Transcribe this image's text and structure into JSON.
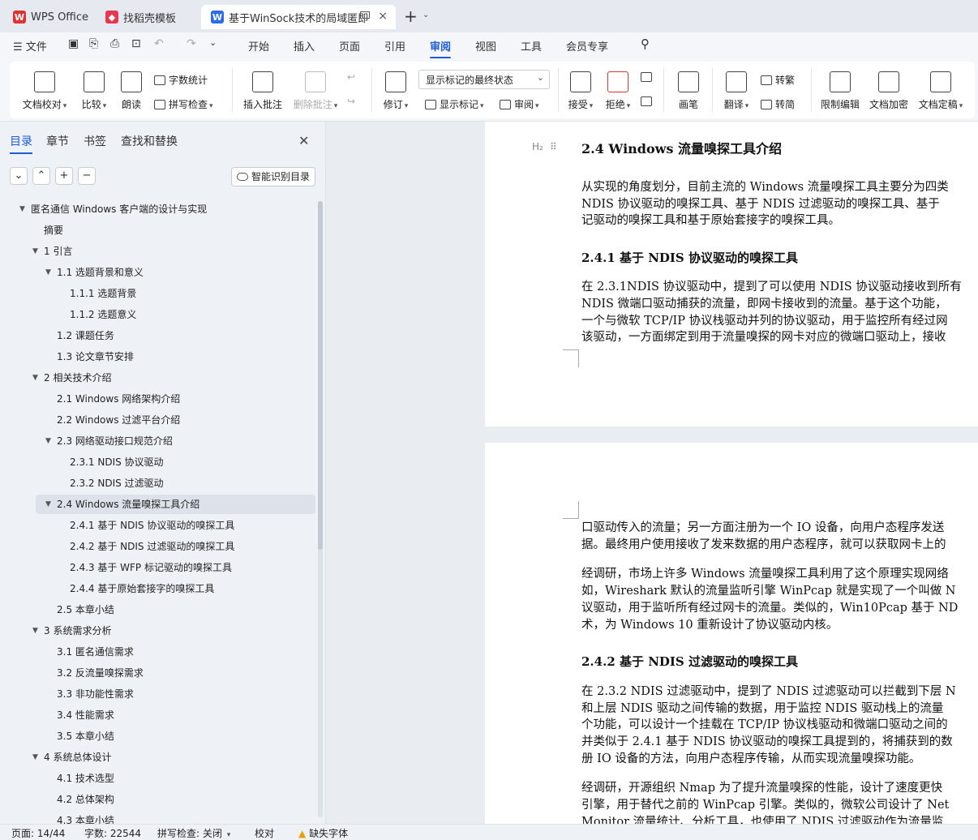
{
  "tabs": [
    {
      "label": "WPS Office",
      "icon": "wps-logo-icon"
    },
    {
      "label": "找稻壳模板",
      "icon": "docer-icon"
    },
    {
      "label": "基于WinSock技术的局域匿即",
      "icon": "word-doc-icon"
    }
  ],
  "new_tab": "+",
  "menu": {
    "file": "文件",
    "items": [
      "开始",
      "插入",
      "页面",
      "引用",
      "审阅",
      "视图",
      "工具",
      "会员专享"
    ],
    "active": "审阅"
  },
  "ribbon": {
    "proofread": "文档校对",
    "compare": "比较",
    "read_aloud": "朗读",
    "word_count": "字数统计",
    "spell_check": "拼写检查",
    "insert_comment": "插入批注",
    "delete_comment": "删除批注",
    "revise": "修订",
    "markup_state": "显示标记的最终状态",
    "show_markup": "显示标记",
    "review": "审阅",
    "accept": "接受",
    "reject": "拒绝",
    "pen": "画笔",
    "translate": "翻译",
    "to_traditional": "转繁",
    "to_simplified": "转简",
    "restrict_edit": "限制编辑",
    "encrypt": "文档加密",
    "finalize": "文档定稿"
  },
  "sidebar": {
    "tabs": [
      "目录",
      "章节",
      "书签",
      "查找和替换"
    ],
    "smart_toc": "智能识别目录",
    "toc": [
      {
        "label": "匿名通信 Windows 客户端的设计与实现",
        "level": 0,
        "arrow": true
      },
      {
        "label": "摘要",
        "level": 1,
        "arrow": false
      },
      {
        "label": "1  引言",
        "level": 1,
        "arrow": true
      },
      {
        "label": "1.1  选题背景和意义",
        "level": 2,
        "arrow": true
      },
      {
        "label": "1.1.1  选题背景",
        "level": 3,
        "arrow": false
      },
      {
        "label": "1.1.2  选题意义",
        "level": 3,
        "arrow": false
      },
      {
        "label": "1.2  课题任务",
        "level": 2,
        "arrow": false
      },
      {
        "label": "1.3  论文章节安排",
        "level": 2,
        "arrow": false
      },
      {
        "label": "2  相关技术介绍",
        "level": 1,
        "arrow": true
      },
      {
        "label": "2.1 Windows  网络架构介绍",
        "level": 2,
        "arrow": false
      },
      {
        "label": "2.2 Windows  过滤平台介绍",
        "level": 2,
        "arrow": false
      },
      {
        "label": "2.3  网络驱动接口规范介绍",
        "level": 2,
        "arrow": true
      },
      {
        "label": "2.3.1 NDIS  协议驱动",
        "level": 3,
        "arrow": false
      },
      {
        "label": "2.3.2 NDIS  过滤驱动",
        "level": 3,
        "arrow": false
      },
      {
        "label": "2.4 Windows  流量嗅探工具介绍",
        "level": 2,
        "arrow": true,
        "selected": true
      },
      {
        "label": "2.4.1  基于  NDIS  协议驱动的嗅探工具",
        "level": 3,
        "arrow": false
      },
      {
        "label": "2.4.2  基于  NDIS  过滤驱动的嗅探工具",
        "level": 3,
        "arrow": false
      },
      {
        "label": "2.4.3  基于  WFP  标记驱动的嗅探工具",
        "level": 3,
        "arrow": false
      },
      {
        "label": "2.4.4  基于原始套接字的嗅探工具",
        "level": 3,
        "arrow": false
      },
      {
        "label": "2.5  本章小结",
        "level": 2,
        "arrow": false
      },
      {
        "label": "3  系统需求分析",
        "level": 1,
        "arrow": true
      },
      {
        "label": "3.1  匿名通信需求",
        "level": 2,
        "arrow": false
      },
      {
        "label": "3.2  反流量嗅探需求",
        "level": 2,
        "arrow": false
      },
      {
        "label": "3.3  非功能性需求",
        "level": 2,
        "arrow": false
      },
      {
        "label": "3.4  性能需求",
        "level": 2,
        "arrow": false
      },
      {
        "label": "3.5  本章小结",
        "level": 2,
        "arrow": false
      },
      {
        "label": "4  系统总体设计",
        "level": 1,
        "arrow": true
      },
      {
        "label": "4.1  技术选型",
        "level": 2,
        "arrow": false
      },
      {
        "label": "4.2  总体架构",
        "level": 2,
        "arrow": false
      },
      {
        "label": "4.3  本章小结",
        "level": 2,
        "arrow": false
      }
    ]
  },
  "doc": {
    "heading_style": "H₂",
    "h24": "2.4 Windows  流量嗅探工具介绍",
    "p1": [
      "从实现的角度划分，目前主流的  Windows  流量嗅探工具主要分为四类",
      "NDIS  协议驱动的嗅探工具、基于  NDIS  过滤驱动的嗅探工具、基于",
      "记驱动的嗅探工具和基于原始套接字的嗅探工具。"
    ],
    "h241": "2.4.1  基于  NDIS  协议驱动的嗅探工具",
    "p2": [
      "在 2.3.1NDIS 协议驱动中，提到了可以使用  NDIS 协议驱动接收到所有",
      "NDIS  微端口驱动捕获的流量，即网卡接收到的流量。基于这个功能，",
      "一个与微软  TCP/IP  协议栈驱动并列的协议驱动，用于监控所有经过网",
      "该驱动，一方面绑定到用于流量嗅探的网卡对应的微端口驱动上，接收"
    ],
    "p3": [
      "口驱动传入的流量；另一方面注册为一个  IO  设备，向用户态程序发送",
      "据。最终用户使用接收了发来数据的用户态程序，就可以获取网卡上的"
    ],
    "p4": [
      "经调研，市场上许多  Windows  流量嗅探工具利用了这个原理实现网络",
      "如，Wireshark  默认的流量监听引擎  WinPcap  就是实现了一个叫做  N",
      "议驱动，用于监听所有经过网卡的流量。类似的，Win10Pcap 基于  ND",
      "术，为  Windows 10  重新设计了协议驱动内核。"
    ],
    "h242": "2.4.2  基于  NDIS  过滤驱动的嗅探工具",
    "p5": [
      "在 2.3.2 NDIS 过滤驱动中，提到了  NDIS 过滤驱动可以拦截到下层  N",
      "和上层  NDIS  驱动之间传输的数据，用于监控  NDIS  驱动栈上的流量",
      "个功能，可以设计一个挂载在  TCP/IP  协议栈驱动和微端口驱动之间的",
      "并类似于 2.4.1  基于  NDIS  协议驱动的嗅探工具提到的，将捕获到的数",
      "册  IO  设备的方法，向用户态程序传输，从而实现流量嗅探功能。"
    ],
    "p6": [
      "经调研，开源组织  Nmap  为了提升流量嗅探的性能，设计了速度更快",
      "引擎，用于替代之前的  WinPcap  引擎。类似的，微软公司设计了  Net",
      "Monitor  流量统计、分析工具，也使用了  NDIS  过滤驱动作为流量监"
    ]
  },
  "status": {
    "page": "页面: 14/44",
    "words": "字数: 22544",
    "spell": "拼写检查: 关闭",
    "proof": "校对",
    "missing_font": "缺失字体"
  },
  "colors": {
    "accent": "#1f5bd6",
    "wps_red": "#e0322f",
    "docer": "#e8384f",
    "word": "#2b6de8"
  }
}
